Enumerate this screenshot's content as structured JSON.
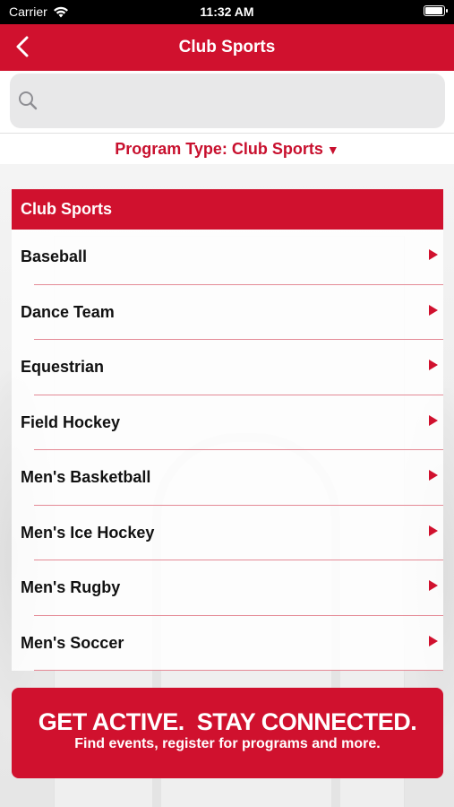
{
  "status_bar": {
    "carrier": "Carrier",
    "time": "11:32 AM",
    "battery_level": 1.0
  },
  "nav": {
    "title": "Club Sports",
    "back_icon": "chevron-left-icon"
  },
  "search": {
    "placeholder": "",
    "value": "",
    "icon": "search-icon"
  },
  "filter": {
    "label": "Program Type: Club Sports",
    "arrow": "▼"
  },
  "list": {
    "header": "Club Sports",
    "items": [
      {
        "label": "Baseball"
      },
      {
        "label": "Dance Team"
      },
      {
        "label": "Equestrian"
      },
      {
        "label": "Field Hockey"
      },
      {
        "label": "Men's Basketball"
      },
      {
        "label": "Men's Ice Hockey"
      },
      {
        "label": "Men's Rugby"
      },
      {
        "label": "Men's Soccer"
      }
    ]
  },
  "banner": {
    "headline": "GET ACTIVE.  STAY CONNECTED.",
    "subline": "Find events, register for programs and more."
  },
  "colors": {
    "brand_red": "#d0112e",
    "separator": "#e48a96",
    "search_bg": "#e8e8e9"
  }
}
